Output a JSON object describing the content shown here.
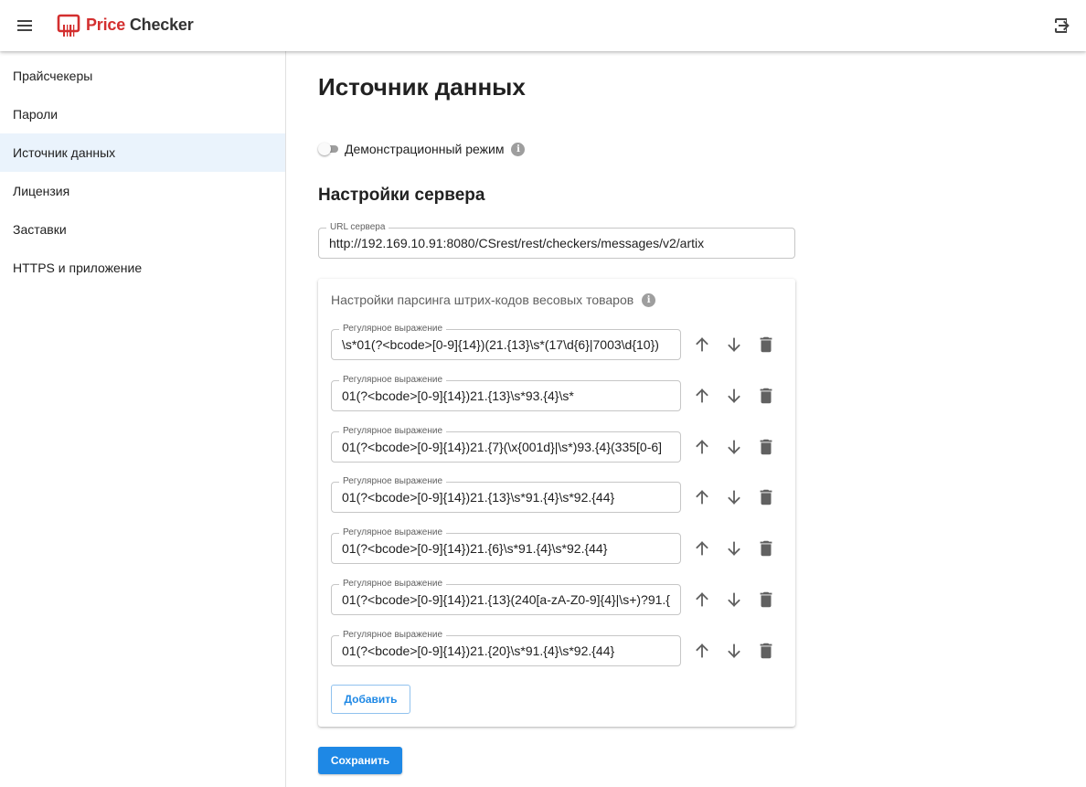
{
  "header": {
    "menu_icon": "menu-icon",
    "logo_icon": "price-tag-barcode-icon",
    "brand_part1": "Price",
    "brand_part2": "Checker",
    "exit_icon": "logout-icon",
    "accent_color": "#d32f2f"
  },
  "sidebar": {
    "items": [
      {
        "label": "Прайсчекеры",
        "active": false
      },
      {
        "label": "Пароли",
        "active": false
      },
      {
        "label": "Источник данных",
        "active": true
      },
      {
        "label": "Лицензия",
        "active": false
      },
      {
        "label": "Заставки",
        "active": false
      },
      {
        "label": "HTTPS и приложение",
        "active": false
      }
    ],
    "active_color": "#eaf3fc"
  },
  "main": {
    "page_title": "Источник данных",
    "demo_mode": {
      "label": "Демонстрационный режим",
      "enabled": false,
      "info_icon": "info-icon"
    },
    "server_settings_title": "Настройки сервера",
    "server_url": {
      "label": "URL сервера",
      "value": "http://192.169.10.91:8080/CSrest/rest/checkers/messages/v2/artix"
    },
    "barcode_card": {
      "title": "Настройки парсинга штрих-кодов весовых товаров",
      "info_icon": "info-icon",
      "regex_label": "Регулярное выражение",
      "regexes": [
        "\\s*01(?<bcode>[0-9]{14})(21.{13}\\s*(17\\d{6}|7003\\d{10})",
        "01(?<bcode>[0-9]{14})21.{13}\\s*93.{4}\\s*",
        "01(?<bcode>[0-9]{14})21.{7}(\\x{001d}|\\s*)93.{4}(335[0-6]",
        "01(?<bcode>[0-9]{14})21.{13}\\s*91.{4}\\s*92.{44}",
        "01(?<bcode>[0-9]{14})21.{6}\\s*91.{4}\\s*92.{44}",
        "01(?<bcode>[0-9]{14})21.{13}(240[a-zA-Z0-9]{4}|\\s+)?91.{",
        "01(?<bcode>[0-9]{14})21.{20}\\s*91.{4}\\s*92.{44}"
      ],
      "row_actions": [
        "arrow-up-icon",
        "arrow-down-icon",
        "trash-icon"
      ],
      "add_label": "Добавить"
    },
    "save_label": "Сохранить",
    "primary_color": "#1e88e5"
  }
}
